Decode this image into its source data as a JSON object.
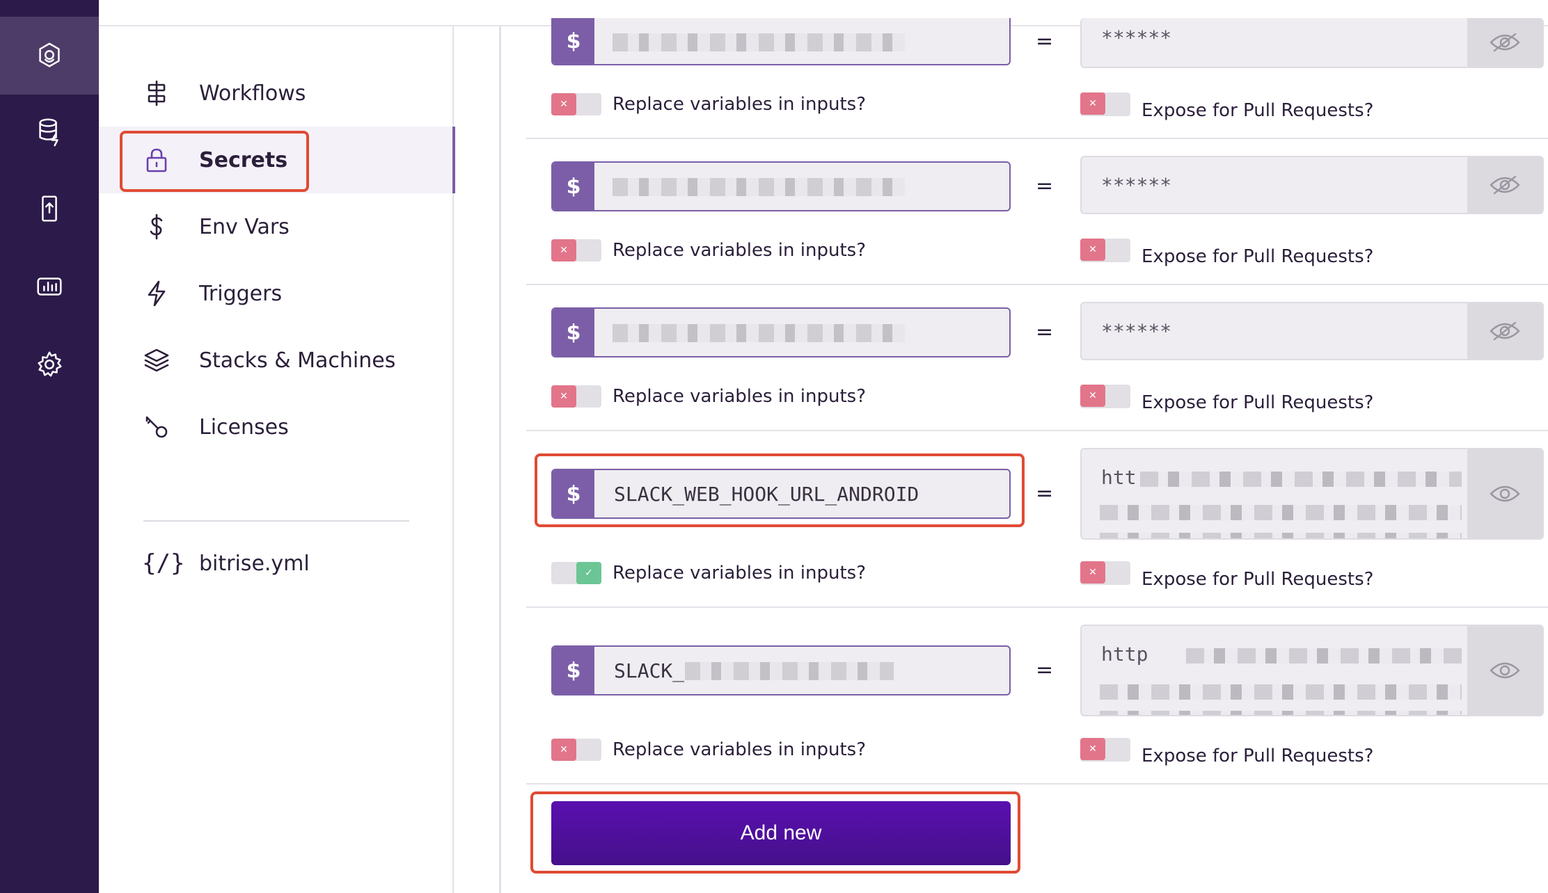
{
  "nav": {
    "items": [
      {
        "label": "Workflows",
        "icon": "workflow-icon"
      },
      {
        "label": "Secrets",
        "icon": "lock-icon",
        "active": true
      },
      {
        "label": "Env Vars",
        "icon": "dollar-icon"
      },
      {
        "label": "Triggers",
        "icon": "lightning-icon"
      },
      {
        "label": "Stacks & Machines",
        "icon": "layers-icon"
      },
      {
        "label": "Licenses",
        "icon": "key-icon"
      }
    ],
    "yml_icon": "{/}",
    "yml_label": "bitrise.yml"
  },
  "secrets": {
    "dollar": "$",
    "equals": "=",
    "replace_label": "Replace variables in inputs?",
    "expose_label": "Expose for Pull Requests?",
    "rows": [
      {
        "key": "",
        "value": "******",
        "replace": false,
        "expose": false
      },
      {
        "key": "",
        "value": "******",
        "replace": false,
        "expose": false
      },
      {
        "key": "",
        "value": "******",
        "replace": false,
        "expose": false
      },
      {
        "key": "SLACK_WEB_HOOK_URL_ANDROID",
        "value": "htt",
        "replace": true,
        "expose": false
      },
      {
        "key": "SLACK_",
        "value": "http",
        "replace": false,
        "expose": false
      }
    ]
  },
  "add_button": "Add new",
  "colors": {
    "rail": "#2c1a4a",
    "accent": "#7b5ea7",
    "button": "#5a10b0",
    "highlight": "#e04b35"
  }
}
